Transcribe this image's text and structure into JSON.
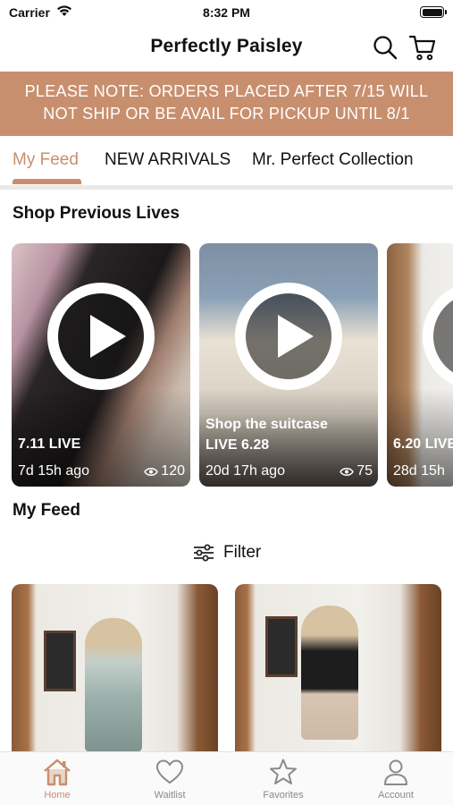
{
  "status_bar": {
    "carrier": "Carrier",
    "time": "8:32 PM"
  },
  "header": {
    "title": "Perfectly Paisley"
  },
  "banner": {
    "line1": "PLEASE NOTE: ORDERS PLACED AFTER 7/15 WILL",
    "line2": "NOT SHIP OR BE AVAIL FOR PICKUP UNTIL 8/1"
  },
  "tabs": [
    {
      "label": "My Feed",
      "active": true
    },
    {
      "label": "NEW ARRIVALS",
      "active": false
    },
    {
      "label": "Mr. Perfect Collection",
      "active": false
    }
  ],
  "shop_previous_lives": {
    "title": "Shop Previous Lives",
    "cards": [
      {
        "caption": "7.11 LIVE",
        "subcaption": "",
        "time_ago": "7d 15h ago",
        "views": "120"
      },
      {
        "caption": "Shop the suitcase",
        "subcaption": "LIVE 6.28",
        "time_ago": "20d 17h ago",
        "views": "75"
      },
      {
        "caption": "6.20 LIVE",
        "subcaption": "",
        "time_ago": "28d 15h",
        "views": ""
      }
    ]
  },
  "my_feed": {
    "title": "My Feed",
    "filter_label": "Filter"
  },
  "tab_bar": [
    {
      "label": "Home",
      "icon": "home-icon",
      "active": true
    },
    {
      "label": "Waitlist",
      "icon": "heart-icon",
      "active": false
    },
    {
      "label": "Favorites",
      "icon": "star-icon",
      "active": false
    },
    {
      "label": "Account",
      "icon": "person-icon",
      "active": false
    }
  ],
  "colors": {
    "accent": "#c88f6e",
    "text": "#111111",
    "inactive": "#8a8a8a"
  }
}
